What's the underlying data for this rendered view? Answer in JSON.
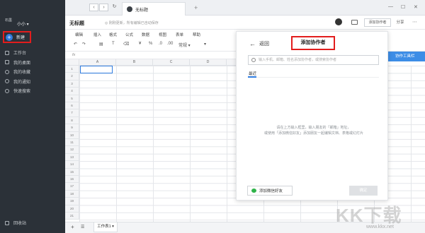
{
  "sidebar": {
    "logo": "石墨",
    "user": "小小 ▾",
    "new_label": "新建",
    "items": [
      {
        "label": "工作台",
        "icon": "briefcase-icon"
      },
      {
        "label": "我的桌面",
        "icon": "desktop-icon"
      },
      {
        "label": "我的收藏",
        "icon": "star-icon"
      },
      {
        "label": "我的通知",
        "icon": "bell-icon"
      },
      {
        "label": "快速搜索",
        "icon": "search-icon"
      }
    ],
    "trash_label": "回收站"
  },
  "window": {
    "tab_title": "无标题",
    "back_arrow": "‹",
    "forward_arrow": "›",
    "reload": "↻",
    "new_tab": "+",
    "minimize": "—",
    "maximize": "☐",
    "close": "✕"
  },
  "doc": {
    "title": "无标题",
    "status": "◎ 刚刚更新，所有编辑已自动保存",
    "collab_button": "添加协作者",
    "share_button": "分享",
    "more": "⋯"
  },
  "menu": [
    "编辑",
    "插入",
    "格式",
    "公式",
    "数据",
    "视图",
    "表单",
    "帮助"
  ],
  "toolbar": {
    "undo": "↶",
    "redo": "↷",
    "format": "▤",
    "clear": "⌫",
    "currency": "¥",
    "percent": "%",
    "dec1": ".0",
    "dec2": ".00",
    "num_format": "常规 ▾"
  },
  "fx": "fx",
  "grid": {
    "columns": [
      "A",
      "B",
      "C",
      "D",
      "E"
    ],
    "rows": [
      "1",
      "2",
      "3",
      "4",
      "5",
      "6",
      "7",
      "8",
      "9",
      "10",
      "11",
      "12",
      "13",
      "14",
      "15",
      "16",
      "17",
      "18",
      "19",
      "20",
      "21"
    ]
  },
  "sheet_tab": "工作表1 ▾",
  "notice": "协作工具栏",
  "panel": {
    "back_label": "返回",
    "back_icon": "←",
    "title": "添加协作者",
    "search_placeholder": "输入手机、邮箱、姓名添加协作者，或搜索协作者",
    "recent_label": "最近",
    "empty_line1": "请在上方输入框里，输入朋友的「邮箱」地址，",
    "empty_line2": "或使用「添加微信好友」添加朋友一起编辑文档、表格或幻灯片",
    "wechat_button": "添加微信好友",
    "confirm_button": "确定"
  },
  "watermark": {
    "text": "KK下载",
    "url": "www.kkx.net"
  },
  "colors": {
    "sidebar_bg": "#2b3138",
    "accent": "#2f7ce0",
    "highlight_box": "#e21d1d",
    "wechat_green": "#2fb34a"
  }
}
